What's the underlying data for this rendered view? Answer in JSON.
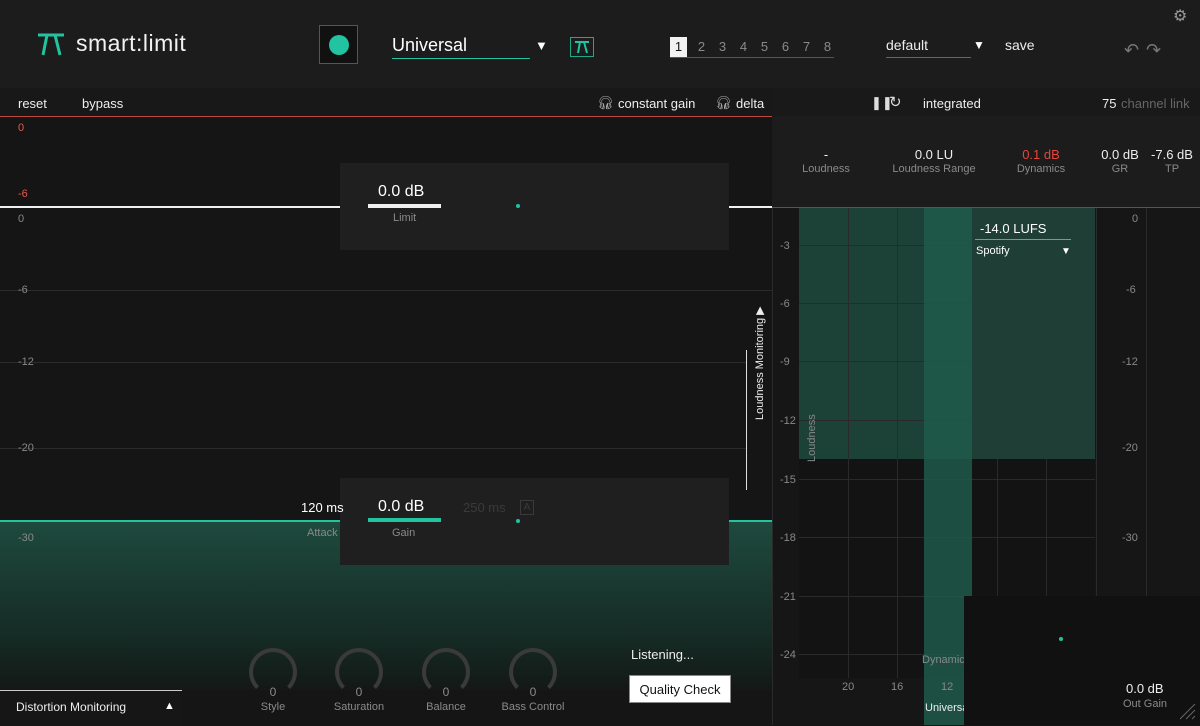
{
  "app": {
    "title": "smart:limit"
  },
  "header": {
    "profile": "Universal",
    "slots": [
      "1",
      "2",
      "3",
      "4",
      "5",
      "6",
      "7",
      "8"
    ],
    "active_slot": "1",
    "preset": "default",
    "save_label": "save"
  },
  "toolbar": {
    "reset": "reset",
    "bypass": "bypass",
    "constant_gain": "constant gain",
    "delta": "delta"
  },
  "graph": {
    "scale_top": [
      "0",
      "-6"
    ],
    "scale": [
      "0",
      "-6",
      "-12",
      "-20",
      "-30"
    ]
  },
  "limit": {
    "value": "0.0 dB",
    "label": "Limit"
  },
  "gain": {
    "value": "0.0 dB",
    "label": "Gain"
  },
  "attack": {
    "value": "120 ms",
    "label": "Attack"
  },
  "release": {
    "value": "250 ms",
    "badge": "A"
  },
  "knobs": [
    {
      "value": "0",
      "label": "Style"
    },
    {
      "value": "0",
      "label": "Saturation"
    },
    {
      "value": "0",
      "label": "Balance"
    },
    {
      "value": "0",
      "label": "Bass Control"
    }
  ],
  "distortion_monitoring": "Distortion Monitoring",
  "listening": "Listening...",
  "quality_check": "Quality Check",
  "loudness_monitoring": "Loudness Monitoring",
  "right": {
    "mode": "integrated",
    "channel_link_value": "75",
    "channel_link": "channel link",
    "meters": [
      {
        "value": "-",
        "label": "Loudness"
      },
      {
        "value": "0.0 LU",
        "label": "Loudness Range"
      },
      {
        "value": "0.1 dB",
        "label": "Dynamics",
        "color": "#e8443a"
      },
      {
        "value": "0.0 dB",
        "label": "GR"
      },
      {
        "value": "-7.6 dB",
        "label": "TP"
      }
    ],
    "left_scale": [
      "-3",
      "-6",
      "-9",
      "-12",
      "-15",
      "-18",
      "-21",
      "-24"
    ],
    "right_scale": [
      "0",
      "-6",
      "-12",
      "-20",
      "-30"
    ],
    "x_labels": [
      "20",
      "16",
      "12"
    ],
    "target": "-14.0 LUFS",
    "target_platform": "Spotify",
    "loudness_axis": "Loudness",
    "dynamics_axis": "Dynamic",
    "universal": "Universa",
    "out_gain_value": "0.0 dB",
    "out_gain_label": "Out Gain"
  },
  "colors": {
    "accent": "#21c3a0",
    "warning": "#e8443a"
  }
}
